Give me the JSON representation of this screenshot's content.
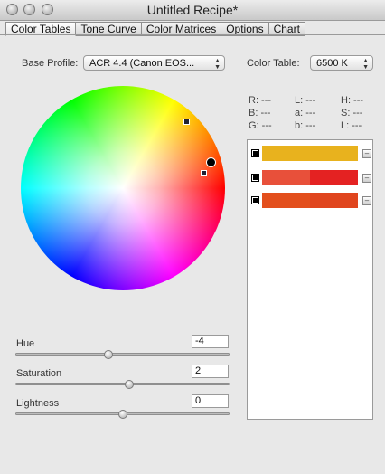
{
  "window": {
    "title": "Untitled Recipe*"
  },
  "tabs": [
    {
      "label": "Color Tables",
      "active": true
    },
    {
      "label": "Tone Curve",
      "active": false
    },
    {
      "label": "Color Matrices",
      "active": false
    },
    {
      "label": "Options",
      "active": false
    },
    {
      "label": "Chart",
      "active": false
    }
  ],
  "base_profile": {
    "label": "Base Profile:",
    "value": "ACR 4.4 (Canon EOS..."
  },
  "color_table": {
    "label": "Color Table:",
    "value": "6500 K"
  },
  "readouts": {
    "col1": [
      "R: ---",
      "B: ---",
      "G: ---"
    ],
    "col2": [
      "L: ---",
      "a: ---",
      "b: ---"
    ],
    "col3": [
      "H: ---",
      "S: ---",
      "L: ---"
    ]
  },
  "swatches": [
    {
      "checked": true,
      "colors": [
        "#e8b21e",
        "#e8b21e"
      ]
    },
    {
      "checked": true,
      "colors": [
        "#e8503a",
        "#e42222"
      ]
    },
    {
      "checked": true,
      "colors": [
        "#e34f1d",
        "#e0451e"
      ]
    }
  ],
  "sliders": {
    "hue": {
      "label": "Hue",
      "value": "-4",
      "fraction": 0.44
    },
    "saturation": {
      "label": "Saturation",
      "value": "2",
      "fraction": 0.53
    },
    "lightness": {
      "label": "Lightness",
      "value": "0",
      "fraction": 0.5
    }
  },
  "colors": {
    "window_bg": "#e8e8e8",
    "list_bg": "#ffffff"
  }
}
